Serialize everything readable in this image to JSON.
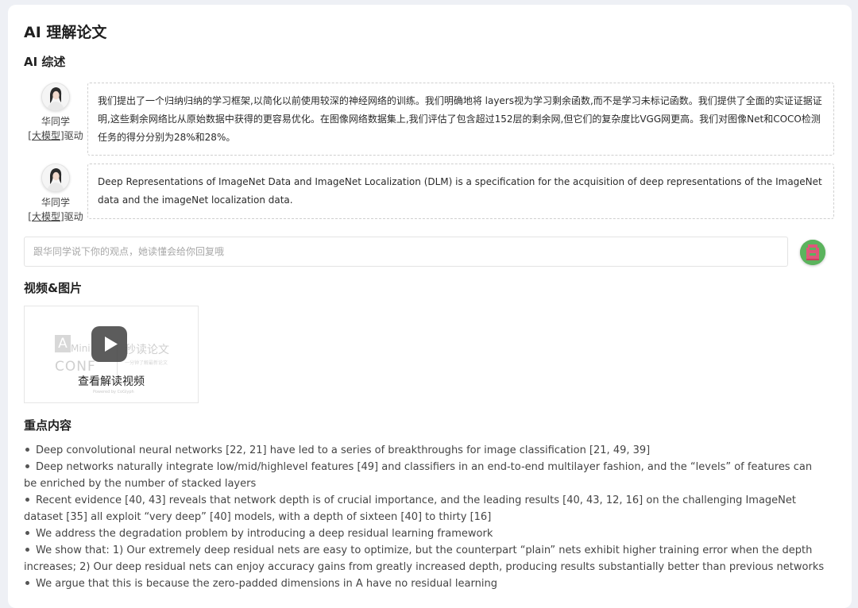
{
  "page": {
    "title": "AI 理解论文"
  },
  "summary": {
    "title": "AI 综述",
    "items": [
      {
        "name": "华同学",
        "driver_open": "[",
        "driver_link": "大模型",
        "driver_close": "]驱动",
        "text": "我们提出了一个归纳归纳的学习框架,以简化以前使用较深的神经网络的训练。我们明确地将 layers视为学习剩余函数,而不是学习未标记函数。我们提供了全面的实证证据证明,这些剩余网络比从原始数据中获得的更容易优化。在图像网络数据集上,我们评估了包含超过152层的剩余网,但它们的复杂度比VGG网更高。我们对图像Net和COCO检测任务的得分分别为28%和28%。"
      },
      {
        "name": "华同学",
        "driver_open": "[",
        "driver_link": "大模型",
        "driver_close": "]驱动",
        "text": "Deep Representations of ImageNet Data and ImageNet Localization (DLM) is a specification for the acquisition of deep representations of the ImageNet data and the imageNet localization data."
      }
    ],
    "input_placeholder": "跟华同学说下你的观点，她读懂会给你回复哦"
  },
  "media": {
    "title": "视频&图片",
    "video_label": "查看解读视频",
    "watermark": {
      "logo_letter": "A",
      "mini": "Mini",
      "conf": "CONF",
      "title": "秒读论文",
      "subtitle": "一分钟了解最新论文",
      "powered": "Powered by CoGlyph"
    }
  },
  "key_points": {
    "title": "重点内容",
    "items": [
      "Deep convolutional neural networks [22, 21] have led to a series of breakthroughs for image classification [21, 49, 39]",
      "Deep networks naturally integrate low/mid/highlevel features [49] and classifiers in an end-to-end multilayer fashion, and the “levels” of features can be enriched by the number of stacked layers",
      "Recent evidence [40, 43] reveals that network depth is of crucial importance, and the leading results [40, 43, 12, 16] on the challenging ImageNet dataset [35] all exploit “very deep” [40] models, with a depth of sixteen [40] to thirty [16]",
      "We address the degradation problem by introducing a deep residual learning framework",
      "We show that: 1) Our extremely deep residual nets are easy to optimize, but the counterpart “plain” nets exhibit higher training error when the depth increases; 2) Our deep residual nets can enjoy accuracy gains from greatly increased depth, producing results substantially better than previous networks",
      "We argue that this is because the zero-padded dimensions in A have no residual learning"
    ]
  },
  "colors": {
    "card_bg": "#ffffff",
    "page_bg": "#eef0f5",
    "bubble_border": "#cfcfcf",
    "user_avatar": "#5bb35d"
  }
}
